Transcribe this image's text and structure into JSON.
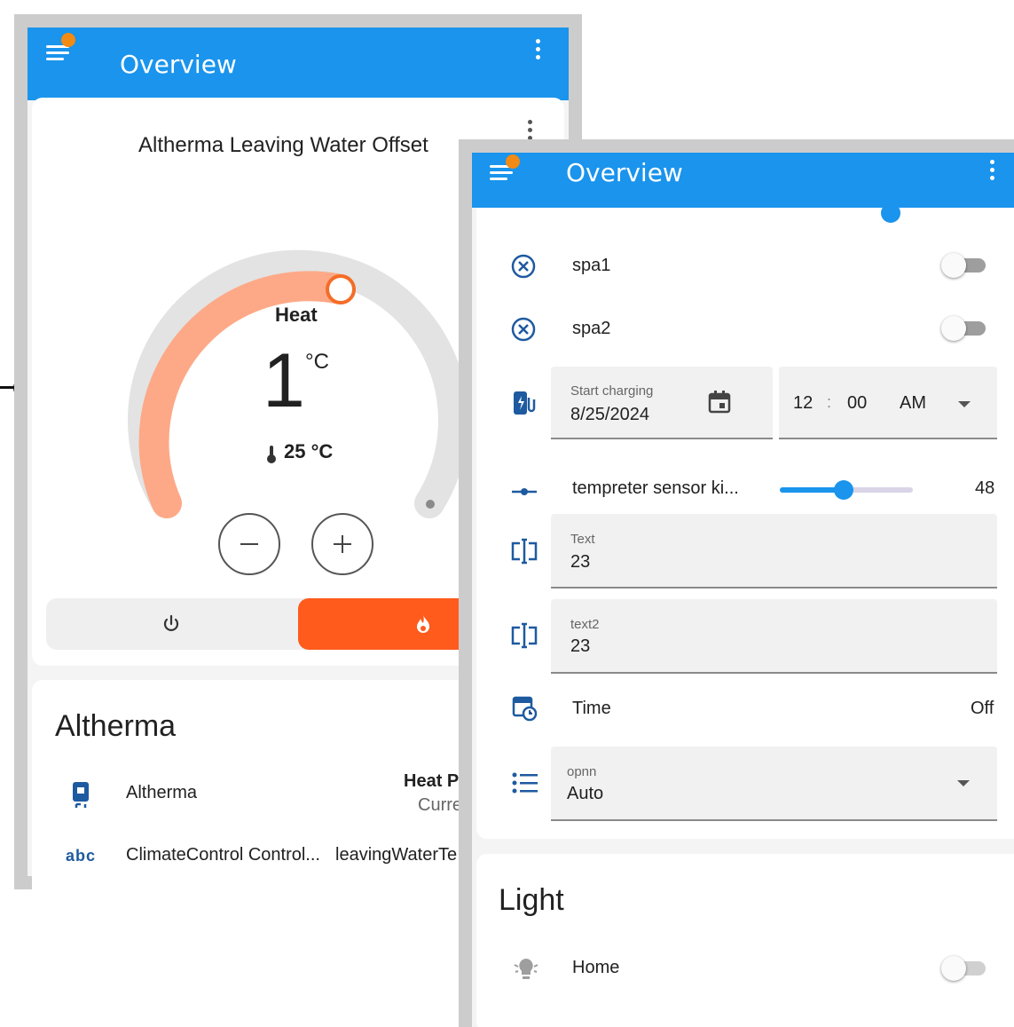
{
  "left_screen": {
    "app_bar": {
      "title": "Overview"
    },
    "thermostat": {
      "title": "Altherma Leaving Water Offset",
      "mode_label": "Heat",
      "target_value": "1",
      "target_unit": "°C",
      "current_temp": "25 °C",
      "arc_fraction": 0.5
    },
    "altherma_card": {
      "heading": "Altherma",
      "rows": [
        {
          "name": "Altherma",
          "value_bold": "Heat P",
          "value_sub": "Curre"
        },
        {
          "icon_text": "abc",
          "name": "ClimateControl Control...",
          "value": "leavingWaterTe"
        }
      ]
    }
  },
  "right_screen": {
    "app_bar": {
      "title": "Overview"
    },
    "entities": {
      "spa1": {
        "name": "spa1",
        "on": false
      },
      "spa2": {
        "name": "spa2",
        "on": false
      },
      "charging": {
        "label": "Start charging",
        "date": "8/25/2024",
        "hour": "12",
        "separator": ":",
        "minute": "00",
        "ampm": "AM"
      },
      "slider": {
        "name": "tempreter sensor ki...",
        "value": "48",
        "fraction": 0.48
      },
      "text1": {
        "label": "Text",
        "value": "23"
      },
      "text2": {
        "label": "text2",
        "value": "23"
      },
      "time": {
        "name": "Time",
        "state": "Off"
      },
      "select": {
        "label": "opnn",
        "value": "Auto"
      }
    },
    "light_card": {
      "heading": "Light",
      "home": {
        "name": "Home",
        "on": false
      }
    }
  },
  "colors": {
    "app_bar": "#1a94ec",
    "badge": "#f38a13",
    "heat_orange": "#fe5b1c",
    "arc_salmon": "#fda987",
    "icon_blue": "#1e5aa0",
    "slider_blue": "#1a94ec"
  }
}
